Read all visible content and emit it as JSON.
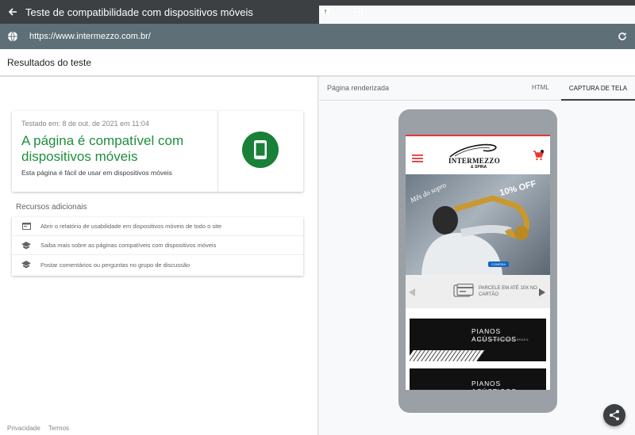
{
  "app": {
    "title": "Teste de compatibilidade com dispositivos móveis",
    "url": "https://www.intermezzo.com.br/"
  },
  "results": {
    "heading": "Resultados do teste",
    "tested_on": "Testado em: 8 de out. de 2021 em 11:04",
    "verdict": "A página é compatível com dispositivos móveis",
    "verdict_sub": "Esta página é fácil de usar em dispositivos móveis",
    "accent_color": "#188038"
  },
  "resources": {
    "title": "Recursos adicionais",
    "items": [
      {
        "icon": "report-icon",
        "label": "Abrir o relatório de usabilidade em dispositivos móveis de todo o site"
      },
      {
        "icon": "school-icon",
        "label": "Saiba mais sobre as páginas compatíveis com dispositivos móveis"
      },
      {
        "icon": "school-icon",
        "label": "Postar comentários ou perguntas no grupo de discussão"
      }
    ]
  },
  "footer": {
    "privacy": "Privacidade",
    "terms": "Termos"
  },
  "right_panel": {
    "rendered_label": "Página renderizada",
    "tabs": [
      {
        "label": "HTML",
        "active": false
      },
      {
        "label": "CAPTURA DE TELA",
        "active": true
      }
    ]
  },
  "preview": {
    "logo_main": "INTERMEZZO",
    "logo_sub": "& SPINA",
    "hero_script": "Mês do sopro",
    "hero_discount": "10% OFF",
    "hero_button": "CONFIRA",
    "installments": "PARCELE EM ATÉ 10X NO CARTÃO",
    "banner1_title": "PIANOS ACÚSTICOS",
    "banner1_sub": "O MAIOR SHOWROOM DO BRASIL",
    "banner2_title": "PIANOS ACÚSTICOS"
  }
}
